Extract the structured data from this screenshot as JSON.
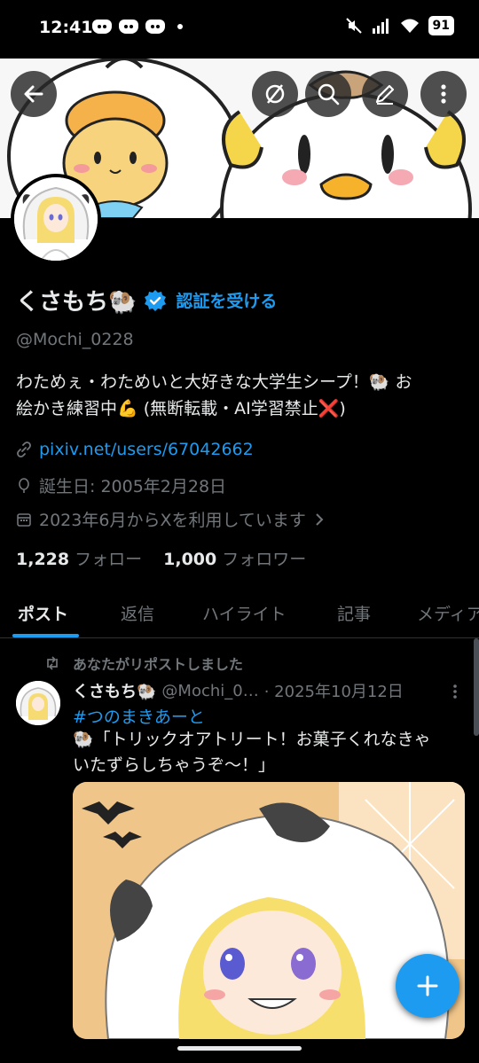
{
  "status_bar": {
    "time": "12:41",
    "battery": "91",
    "notification_icons": [
      "discord-icon",
      "discord-icon",
      "discord-icon",
      "dot-icon"
    ],
    "system_icons": [
      "mute-icon",
      "signal-icon",
      "wifi-icon",
      "battery-icon"
    ]
  },
  "profile": {
    "name": "くさもち🐏",
    "verify_label": "認証を受ける",
    "handle": "@Mochi_0228",
    "bio_line1": "わためぇ・わためいと大好きな大学生シープ！🐏 お",
    "bio_line2": "絵かき練習中💪 (無断転載・AI学習禁止❌)",
    "link": "pixiv.net/users/67042662",
    "birthday": "誕生日: 2005年2月28日",
    "joined": "2023年6月からXを利用しています",
    "following_count": "1,228",
    "following_label": "フォロー",
    "followers_count": "1,000",
    "followers_label": "フォロワー"
  },
  "tabs": [
    {
      "label": "ポスト",
      "active": true
    },
    {
      "label": "返信",
      "active": false
    },
    {
      "label": "ハイライト",
      "active": false
    },
    {
      "label": "記事",
      "active": false
    },
    {
      "label": "メディア",
      "active": false
    }
  ],
  "post": {
    "repost_label": "あなたがリポストしました",
    "author_name": "くさもち🐏",
    "author_handle": "@Mochi_0…",
    "date": "· 2025年10月12日",
    "hashtag": "#つのまきあーと",
    "text_line1": "🐏「トリックオアトリート！お菓子くれなきゃ",
    "text_line2": "いたずらしちゃうぞ〜！」"
  },
  "colors": {
    "accent": "#1d9bf0",
    "background": "#000000",
    "text_primary": "#e7e9ea",
    "text_secondary": "#71767b"
  }
}
